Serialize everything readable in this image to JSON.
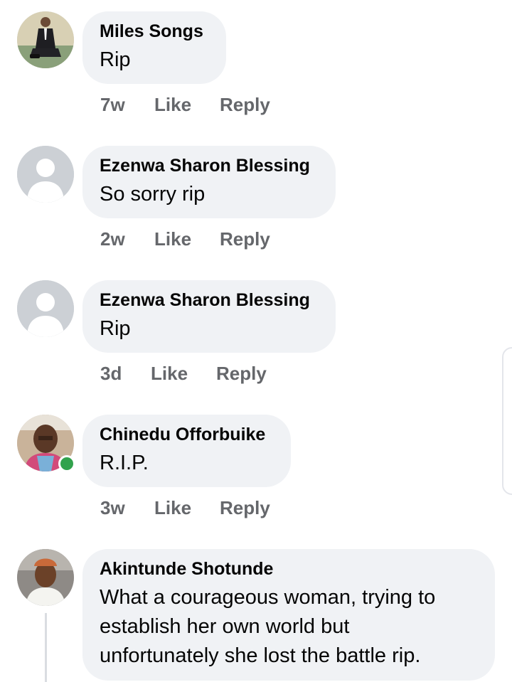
{
  "comments": [
    {
      "author": "Miles Songs",
      "text": "Rip",
      "time": "7w",
      "like_label": "Like",
      "reply_label": "Reply",
      "avatar": "photo-man-in-suit"
    },
    {
      "author": "Ezenwa Sharon Blessing",
      "text": "So sorry rip",
      "time": "2w",
      "like_label": "Like",
      "reply_label": "Reply",
      "avatar": "default-avatar-icon"
    },
    {
      "author": "Ezenwa Sharon Blessing",
      "text": "Rip",
      "time": "3d",
      "like_label": "Like",
      "reply_label": "Reply",
      "avatar": "default-avatar-icon"
    },
    {
      "author": "Chinedu Offorbuike",
      "text": "R.I.P.",
      "time": "3w",
      "like_label": "Like",
      "reply_label": "Reply",
      "avatar": "photo-man",
      "online": true
    },
    {
      "author": "Akintunde Shotunde",
      "text_lines": [
        "What a courageous woman, trying to",
        "establish her own world but",
        "unfortunately she lost the battle rip."
      ],
      "avatar": "photo-man-with-cap"
    }
  ],
  "colors": {
    "bubble": "#f0f2f5",
    "text": "#050505",
    "meta": "#65676b",
    "online": "#31a24c",
    "default_avatar_bg": "#ccd0d5"
  }
}
